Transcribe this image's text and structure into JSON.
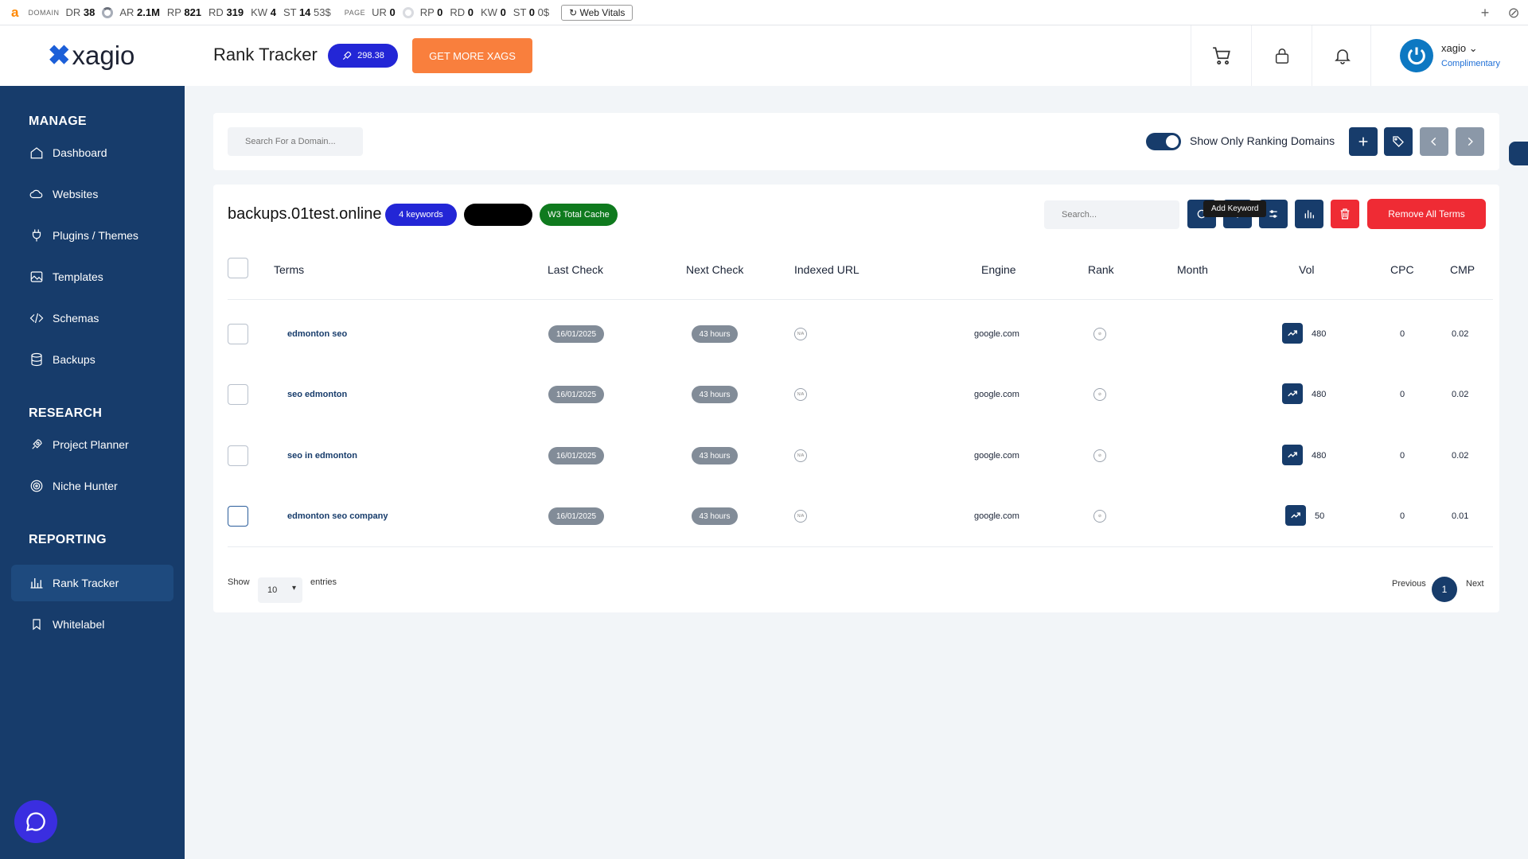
{
  "ahrefs_bar": {
    "logo": "a",
    "domain_label": "DOMAIN",
    "domain_metrics": [
      {
        "k": "DR",
        "v": "38"
      },
      {
        "k": "AR",
        "v": "2.1M"
      },
      {
        "k": "RP",
        "v": "821"
      },
      {
        "k": "RD",
        "v": "319"
      },
      {
        "k": "KW",
        "v": "4"
      },
      {
        "k": "ST",
        "v": "14"
      }
    ],
    "domain_st_suffix": "53$",
    "page_label": "PAGE",
    "page_metrics": [
      {
        "k": "UR",
        "v": "0"
      },
      {
        "k": "RP",
        "v": "0"
      },
      {
        "k": "RD",
        "v": "0"
      },
      {
        "k": "KW",
        "v": "0"
      },
      {
        "k": "ST",
        "v": "0"
      }
    ],
    "page_st_suffix": "0$",
    "web_vitals": "Web Vitals"
  },
  "header": {
    "brand": "xagio",
    "page_title": "Rank Tracker",
    "xags_balance": "298.38",
    "get_more_label": "GET MORE XAGS",
    "user_name": "xagio",
    "user_plan": "Complimentary"
  },
  "sidebar": {
    "sections": {
      "manage": "MANAGE",
      "research": "RESEARCH",
      "reporting": "REPORTING"
    },
    "items": [
      {
        "label": "Dashboard",
        "icon": "home-icon"
      },
      {
        "label": "Websites",
        "icon": "cloud-icon"
      },
      {
        "label": "Plugins / Themes",
        "icon": "plug-icon"
      },
      {
        "label": "Templates",
        "icon": "image-icon"
      },
      {
        "label": "Schemas",
        "icon": "code-icon"
      },
      {
        "label": "Backups",
        "icon": "database-icon"
      },
      {
        "label": "Project Planner",
        "icon": "rocket-icon"
      },
      {
        "label": "Niche Hunter",
        "icon": "target-icon"
      },
      {
        "label": "Rank Tracker",
        "icon": "bar-chart-icon",
        "active": true
      },
      {
        "label": "Whitelabel",
        "icon": "bookmark-icon"
      }
    ]
  },
  "filter_bar": {
    "search_placeholder": "Search For a Domain...",
    "toggle_label": "Show Only Ranking Domains",
    "toggle_on": true
  },
  "domain_card": {
    "domain": "backups.01test.online",
    "keywords_badge": "4 keywords",
    "cache_badge": "W3 Total Cache",
    "search_placeholder": "Search...",
    "tooltip": "Add Keyword",
    "remove_all_label": "Remove All Terms",
    "columns": [
      "Terms",
      "Last Check",
      "Next Check",
      "Indexed URL",
      "Engine",
      "Rank",
      "Month",
      "Vol",
      "CPC",
      "CMP"
    ],
    "rows": [
      {
        "term": "edmonton seo",
        "last_check": "16/01/2025",
        "next_check": "43 hours",
        "indexed": "N/A",
        "engine": "google.com",
        "month": "",
        "vol": "480",
        "cpc": "0",
        "cmp": "0.02"
      },
      {
        "term": "seo edmonton",
        "last_check": "16/01/2025",
        "next_check": "43 hours",
        "indexed": "N/A",
        "engine": "google.com",
        "month": "",
        "vol": "480",
        "cpc": "0",
        "cmp": "0.02"
      },
      {
        "term": "seo in edmonton",
        "last_check": "16/01/2025",
        "next_check": "43 hours",
        "indexed": "N/A",
        "engine": "google.com",
        "month": "",
        "vol": "480",
        "cpc": "0",
        "cmp": "0.02"
      },
      {
        "term": "edmonton seo company",
        "last_check": "16/01/2025",
        "next_check": "43 hours",
        "indexed": "N/A",
        "engine": "google.com",
        "month": "",
        "vol": "50",
        "cpc": "0",
        "cmp": "0.01"
      }
    ],
    "show_label": "Show",
    "entries_value": "10",
    "entries_label": "entries",
    "prev_label": "Previous",
    "page_number": "1",
    "next_label": "Next"
  },
  "colors": {
    "navy": "#173c6b",
    "accent_orange": "#f97f3d",
    "badge_blue": "#2326d6",
    "danger_red": "#ef2b34",
    "cache_green": "#0f7a1e"
  }
}
